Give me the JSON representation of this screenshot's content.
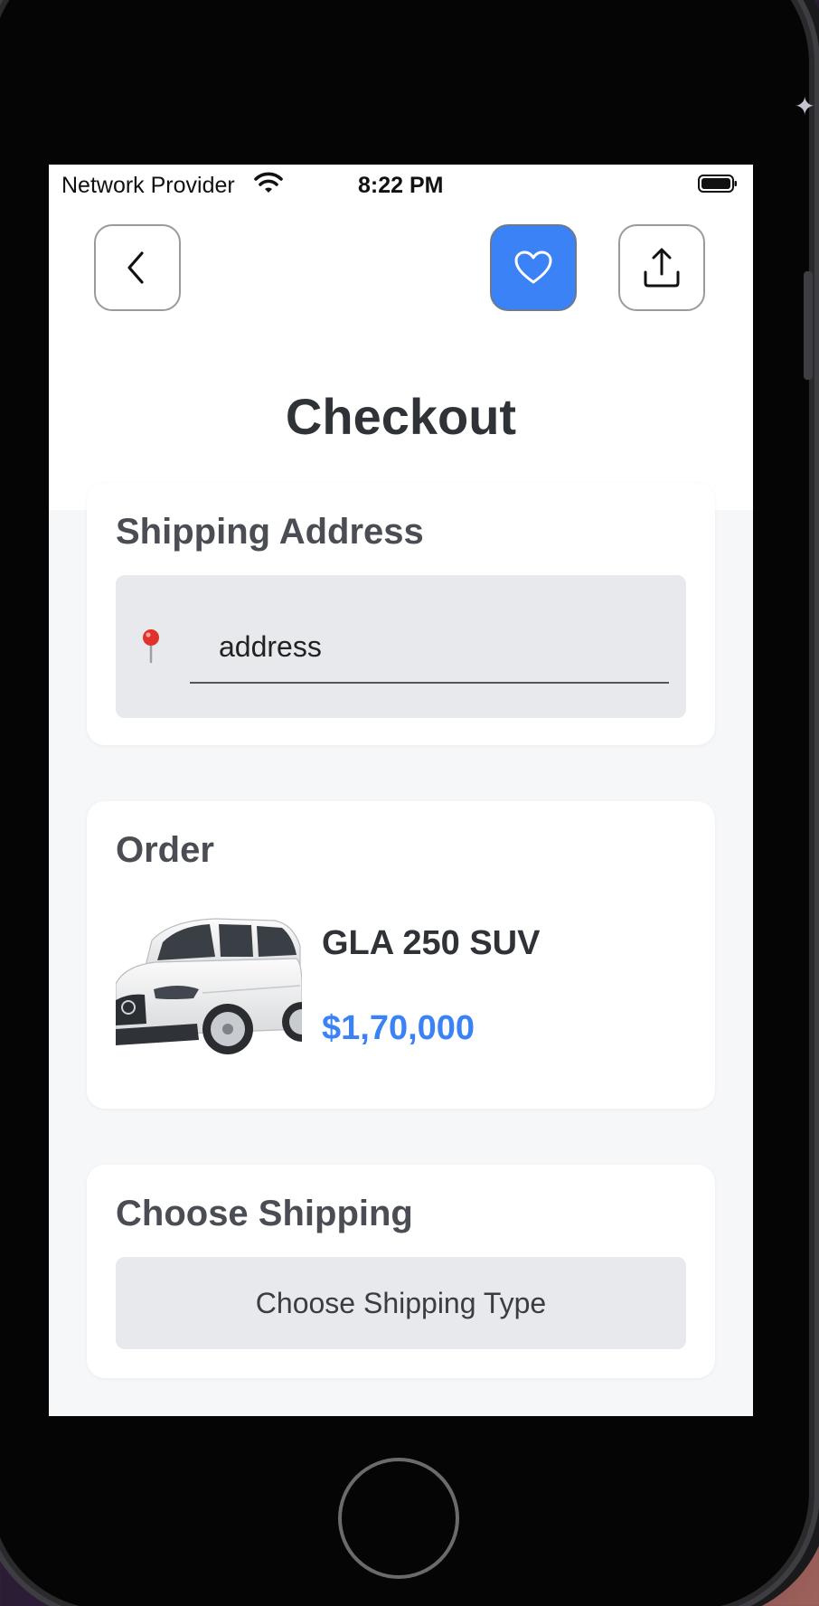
{
  "status_bar": {
    "carrier": "Network Provider",
    "time": "8:22 PM"
  },
  "nav": {
    "back_icon": "chevron-left-icon",
    "favorite_icon": "heart-icon",
    "share_icon": "share-icon",
    "favorite_color": "#3b82f6"
  },
  "page": {
    "title": "Checkout"
  },
  "shipping_address": {
    "title": "Shipping Address",
    "input_placeholder": "address",
    "icon": "map-pin-icon"
  },
  "order": {
    "title": "Order",
    "product_name": "GLA 250 SUV",
    "price": "$1,70,000",
    "price_color": "#3b82f6",
    "image": "car-image"
  },
  "choose_shipping": {
    "title": "Choose Shipping",
    "button_label": "Choose Shipping Type"
  }
}
